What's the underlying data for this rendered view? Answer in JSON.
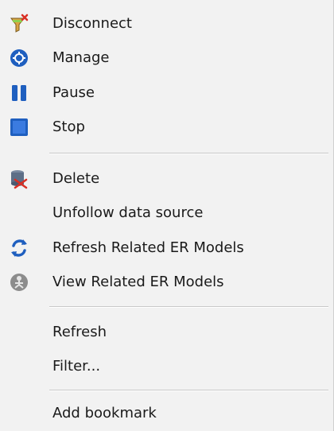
{
  "menu": {
    "items": [
      {
        "label": "Disconnect",
        "icon": "funnel-disconnect-icon"
      },
      {
        "label": "Manage",
        "icon": "manage-icon"
      },
      {
        "label": "Pause",
        "icon": "pause-icon"
      },
      {
        "label": "Stop",
        "icon": "stop-icon"
      },
      {
        "label": "Delete",
        "icon": "database-delete-icon"
      },
      {
        "label": "Unfollow data source",
        "icon": ""
      },
      {
        "label": "Refresh Related ER Models",
        "icon": "refresh-arrows-icon"
      },
      {
        "label": "View Related ER Models",
        "icon": "view-models-icon"
      },
      {
        "label": "Refresh",
        "icon": ""
      },
      {
        "label": "Filter...",
        "icon": ""
      },
      {
        "label": "Add bookmark",
        "icon": ""
      }
    ]
  },
  "colors": {
    "menu_background": "#f2f2f2",
    "separator": "#c8c8c8",
    "icon_blue": "#1f5fbf",
    "icon_red": "#d93025"
  }
}
